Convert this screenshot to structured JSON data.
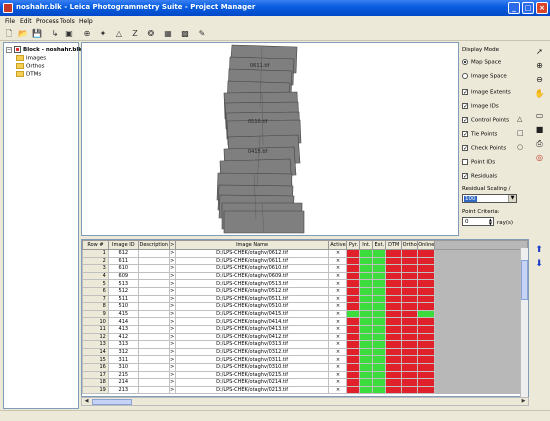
{
  "window": {
    "title": "noshahr.blk - Leica Photogrammetry Suite - Project Manager",
    "min_label": "_",
    "max_label": "□",
    "close_label": "×"
  },
  "menu": [
    "File",
    "Edit",
    "Process",
    "Tools",
    "Help"
  ],
  "toolbar_icons": [
    "new-icon",
    "open-icon",
    "save-icon",
    "import-icon",
    "frame-editor-icon",
    "point-measurement-icon",
    "tie-point-icon",
    "triangulation-icon",
    "z-icon",
    "dtm-icon",
    "ortho-icon",
    "mosaic-icon",
    "feature-icon"
  ],
  "tree": {
    "root": "Block - noshahr.blk",
    "children": [
      "Images",
      "Orthos",
      "DTMs"
    ]
  },
  "canvas": {
    "image_labels": [
      "0611.tif",
      "0510.tif",
      "0415.tif"
    ]
  },
  "display_mode": {
    "title": "Display Mode",
    "map_space": "Map Space",
    "image_space": "Image Space",
    "options": [
      {
        "label": "Image Extents",
        "checked": true
      },
      {
        "label": "Image IDs",
        "checked": true
      },
      {
        "label": "Control Points",
        "checked": true
      },
      {
        "label": "Tie Points",
        "checked": true
      },
      {
        "label": "Check Points",
        "checked": true
      },
      {
        "label": "Point IDs",
        "checked": false
      },
      {
        "label": "Residuals",
        "checked": true
      }
    ],
    "residual_scaling_label": "Residual Scaling /",
    "residual_scaling_value": "100",
    "point_criteria_label": "Point Criteria:",
    "point_criteria_value": "0",
    "point_criteria_unit": "ray(s)"
  },
  "table": {
    "headers": [
      "Row #",
      "Image ID",
      "Description",
      ">",
      "Image Name",
      "Active",
      "Pyr.",
      "Int.",
      "Ext.",
      "DTM",
      "Ortho",
      "Online"
    ],
    "rows": [
      {
        "row": "1",
        "id": "612",
        "name": "D:/LPS-CHEK/otaghv/0612.tif",
        "pyr": "red",
        "int": "green",
        "ext": "green",
        "dtm": "red",
        "ortho": "red",
        "online": "red"
      },
      {
        "row": "2",
        "id": "611",
        "name": "D:/LPS-CHEK/otaghv/0611.tif",
        "pyr": "red",
        "int": "green",
        "ext": "green",
        "dtm": "red",
        "ortho": "red",
        "online": "red"
      },
      {
        "row": "3",
        "id": "610",
        "name": "D:/LPS-CHEK/otaghv/0610.tif",
        "pyr": "red",
        "int": "green",
        "ext": "green",
        "dtm": "red",
        "ortho": "red",
        "online": "red"
      },
      {
        "row": "4",
        "id": "609",
        "name": "D:/LPS-CHEK/otaghv/0609.tif",
        "pyr": "red",
        "int": "green",
        "ext": "green",
        "dtm": "red",
        "ortho": "red",
        "online": "red"
      },
      {
        "row": "5",
        "id": "513",
        "name": "D:/LPS-CHEK/otaghv/0513.tif",
        "pyr": "red",
        "int": "green",
        "ext": "green",
        "dtm": "red",
        "ortho": "red",
        "online": "red"
      },
      {
        "row": "6",
        "id": "512",
        "name": "D:/LPS-CHEK/otaghv/0512.tif",
        "pyr": "red",
        "int": "green",
        "ext": "green",
        "dtm": "red",
        "ortho": "red",
        "online": "red"
      },
      {
        "row": "7",
        "id": "511",
        "name": "D:/LPS-CHEK/otaghv/0511.tif",
        "pyr": "red",
        "int": "green",
        "ext": "green",
        "dtm": "red",
        "ortho": "red",
        "online": "red"
      },
      {
        "row": "8",
        "id": "510",
        "name": "D:/LPS-CHEK/otaghv/0510.tif",
        "pyr": "red",
        "int": "green",
        "ext": "green",
        "dtm": "red",
        "ortho": "red",
        "online": "red"
      },
      {
        "row": "9",
        "id": "415",
        "name": "D:/LPS-CHEK/otaghv/0415.tif",
        "pyr": "green",
        "int": "green",
        "ext": "green",
        "dtm": "red",
        "ortho": "red",
        "online": "green"
      },
      {
        "row": "10",
        "id": "414",
        "name": "D:/LPS-CHEK/otaghv/0414.tif",
        "pyr": "red",
        "int": "green",
        "ext": "green",
        "dtm": "red",
        "ortho": "red",
        "online": "red"
      },
      {
        "row": "11",
        "id": "413",
        "name": "D:/LPS-CHEK/otaghv/0413.tif",
        "pyr": "red",
        "int": "green",
        "ext": "green",
        "dtm": "red",
        "ortho": "red",
        "online": "red"
      },
      {
        "row": "12",
        "id": "412",
        "name": "D:/LPS-CHEK/otaghv/0412.tif",
        "pyr": "red",
        "int": "green",
        "ext": "green",
        "dtm": "red",
        "ortho": "red",
        "online": "red"
      },
      {
        "row": "13",
        "id": "313",
        "name": "D:/LPS-CHEK/otaghv/0313.tif",
        "pyr": "red",
        "int": "green",
        "ext": "green",
        "dtm": "red",
        "ortho": "red",
        "online": "red"
      },
      {
        "row": "14",
        "id": "312",
        "name": "D:/LPS-CHEK/otaghv/0312.tif",
        "pyr": "red",
        "int": "green",
        "ext": "green",
        "dtm": "red",
        "ortho": "red",
        "online": "red"
      },
      {
        "row": "15",
        "id": "311",
        "name": "D:/LPS-CHEK/otaghv/0311.tif",
        "pyr": "red",
        "int": "green",
        "ext": "green",
        "dtm": "red",
        "ortho": "red",
        "online": "red"
      },
      {
        "row": "16",
        "id": "310",
        "name": "D:/LPS-CHEK/otaghv/0310.tif",
        "pyr": "red",
        "int": "green",
        "ext": "green",
        "dtm": "red",
        "ortho": "red",
        "online": "red"
      },
      {
        "row": "17",
        "id": "215",
        "name": "D:/LPS-CHEK/otaghv/0215.tif",
        "pyr": "red",
        "int": "green",
        "ext": "green",
        "dtm": "red",
        "ortho": "red",
        "online": "red"
      },
      {
        "row": "18",
        "id": "214",
        "name": "D:/LPS-CHEK/otaghv/0214.tif",
        "pyr": "red",
        "int": "green",
        "ext": "green",
        "dtm": "red",
        "ortho": "red",
        "online": "red"
      },
      {
        "row": "19",
        "id": "213",
        "name": "D:/LPS-CHEK/otaghv/0213.tif",
        "pyr": "red",
        "int": "green",
        "ext": "green",
        "dtm": "red",
        "ortho": "red",
        "online": "red"
      }
    ],
    "active_mark": "×"
  }
}
